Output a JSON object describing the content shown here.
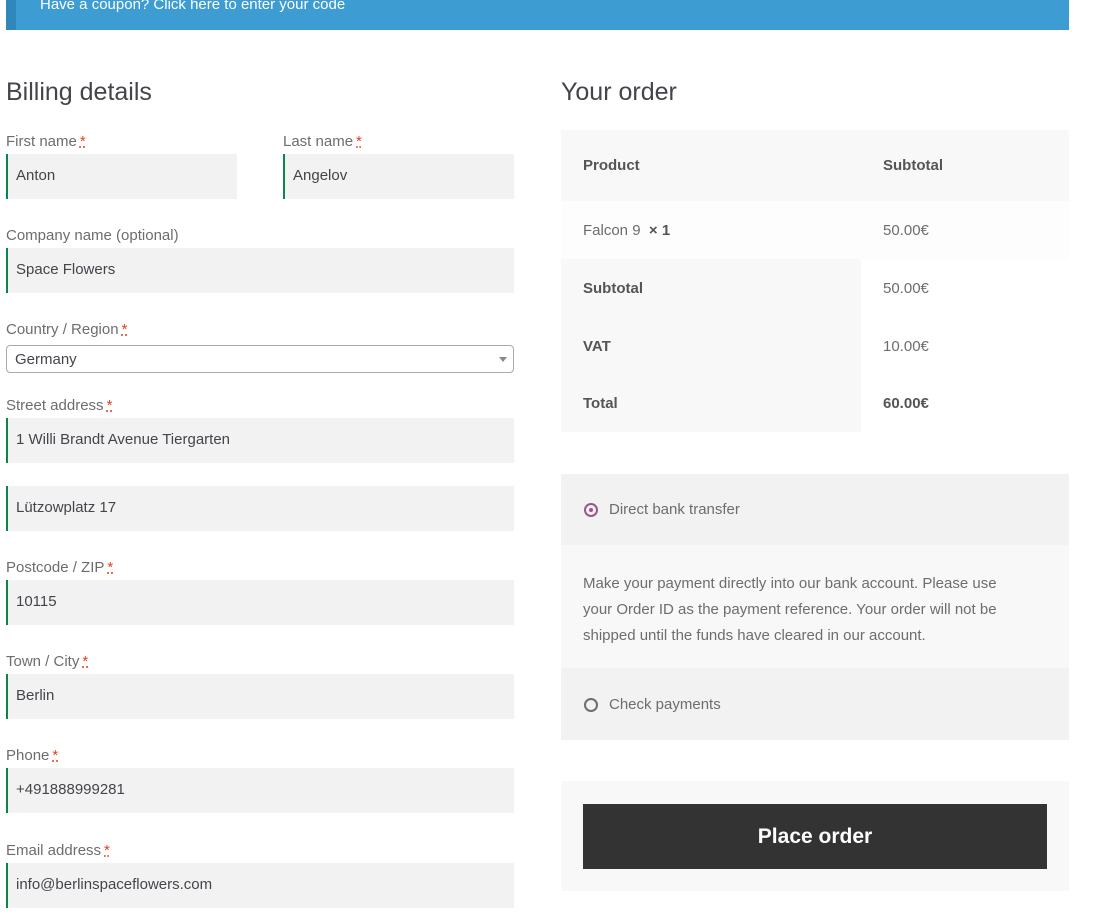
{
  "notice": {
    "coupon_text": "Have a coupon? Click here to enter your code"
  },
  "billing": {
    "title": "Billing details",
    "required_marker": "*",
    "first_name": {
      "label": "First name",
      "value": "Anton"
    },
    "last_name": {
      "label": "Last name",
      "value": "Angelov"
    },
    "company": {
      "label": "Company name (optional)",
      "value": "Space Flowers"
    },
    "country": {
      "label": "Country / Region",
      "value": "Germany"
    },
    "street": {
      "label": "Street address",
      "value1": "1 Willi Brandt Avenue Tiergarten",
      "value2": "Lützowplatz 17"
    },
    "postcode": {
      "label": "Postcode / ZIP",
      "value": "10115"
    },
    "city": {
      "label": "Town / City",
      "value": "Berlin"
    },
    "phone": {
      "label": "Phone",
      "value": "+491888999281"
    },
    "email": {
      "label": "Email address",
      "value": "info@berlinspaceflowers.com"
    }
  },
  "order": {
    "title": "Your order",
    "headers": {
      "product": "Product",
      "subtotal": "Subtotal"
    },
    "item": {
      "name": "Falcon 9",
      "qty": "× 1",
      "price": "50.00€"
    },
    "subtotal": {
      "label": "Subtotal",
      "value": "50.00€"
    },
    "vat": {
      "label": "VAT",
      "value": "10.00€"
    },
    "total": {
      "label": "Total",
      "value": "60.00€"
    }
  },
  "payment": {
    "bank": {
      "label": "Direct bank transfer",
      "description": "Make your payment directly into our bank account. Please use your Order ID as the payment reference. Your order will not be shipped until the funds have cleared in our account."
    },
    "check": {
      "label": "Check payments"
    },
    "place_order": "Place order"
  },
  "colors": {
    "accent_green": "#0f834d",
    "notice_blue": "#3d9cd2",
    "radio_purple": "#96588a",
    "button_dark": "#333333"
  }
}
